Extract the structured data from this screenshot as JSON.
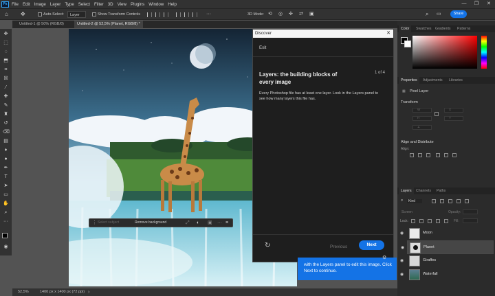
{
  "app": {
    "logo": "Ps",
    "menu": [
      "File",
      "Edit",
      "Image",
      "Layer",
      "Type",
      "Select",
      "Filter",
      "3D",
      "View",
      "Plugins",
      "Window",
      "Help"
    ]
  },
  "options": {
    "auto_select": "Auto-Select:",
    "target": "Layer",
    "transform": "Show Transform Controls",
    "mode3d": "3D Mode:",
    "share": "Share"
  },
  "tabs": [
    "Untitled-1 @ 50% (RGB/8)",
    "Untitled-2 @ 52,5% (Planet, RGB/8) *"
  ],
  "discover": {
    "header": "Discover",
    "exit": "Exit",
    "title": "Layers: the building blocks of every image",
    "step": "1 of 4",
    "body": "Every Photoshop file has at least one layer. Look in the Layers panel to see how many layers this file has.",
    "previous": "Previous",
    "next": "Next"
  },
  "tooltip": {
    "text": "with the Layers panel to edit this image. Click Next to continue."
  },
  "taskbar": {
    "select_subject": "Select subject",
    "remove_bg": "Remove background"
  },
  "status": {
    "zoom": "52,5%",
    "size": "1400 px x 1400 px (72 ppi)"
  },
  "panels": {
    "color_tabs": [
      "Color",
      "Swatches",
      "Gradients",
      "Patterns"
    ],
    "props_tabs": [
      "Properties",
      "Adjustments",
      "Libraries"
    ],
    "pixel_layer": "Pixel Layer",
    "transform": "Transform",
    "align": "Align and Distribute",
    "align_sub": "Align:",
    "layers_tabs": [
      "Layers",
      "Channels",
      "Paths"
    ],
    "kind": "Kind",
    "blend": "Screen",
    "opacity": "Opacity:",
    "lock": "Lock:",
    "fill": "Fill:",
    "layers": [
      {
        "name": "Moon",
        "selected": false
      },
      {
        "name": "Planet",
        "selected": true
      },
      {
        "name": "Giraffes",
        "selected": false
      },
      {
        "name": "Waterfall",
        "selected": false
      }
    ]
  },
  "colors": {
    "accent": "#1473e6",
    "chrome": "#323232",
    "panel": "#2b2b2b"
  }
}
